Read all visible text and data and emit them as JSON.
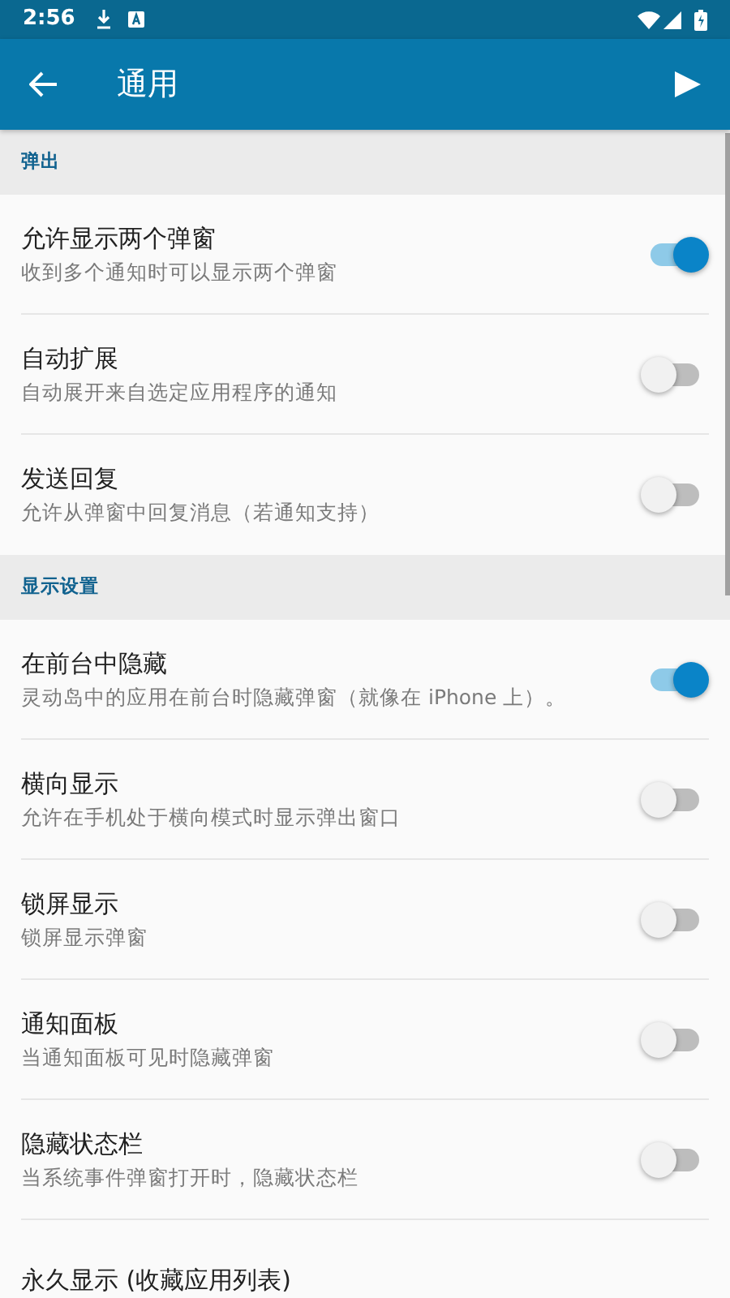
{
  "status_bar": {
    "time": "2:56"
  },
  "app_bar": {
    "title": "通用"
  },
  "sections": [
    {
      "header": "弹出",
      "items": [
        {
          "title": "允许显示两个弹窗",
          "subtitle": "收到多个通知时可以显示两个弹窗",
          "on": true
        },
        {
          "title": "自动扩展",
          "subtitle": "自动展开来自选定应用程序的通知",
          "on": false
        },
        {
          "title": "发送回复",
          "subtitle": "允许从弹窗中回复消息（若通知支持）",
          "on": false
        }
      ]
    },
    {
      "header": "显示设置",
      "items": [
        {
          "title": "在前台中隐藏",
          "subtitle": "灵动岛中的应用在前台时隐藏弹窗（就像在 iPhone 上）。",
          "on": true
        },
        {
          "title": "横向显示",
          "subtitle": "允许在手机处于横向模式时显示弹出窗口",
          "on": false
        },
        {
          "title": "锁屏显示",
          "subtitle": "锁屏显示弹窗",
          "on": false
        },
        {
          "title": "通知面板",
          "subtitle": "当通知面板可见时隐藏弹窗",
          "on": false
        },
        {
          "title": "隐藏状态栏",
          "subtitle": "当系统事件弹窗打开时，隐藏状态栏",
          "on": false
        },
        {
          "title": "永久显示 (收藏应用列表)"
        }
      ]
    }
  ]
}
